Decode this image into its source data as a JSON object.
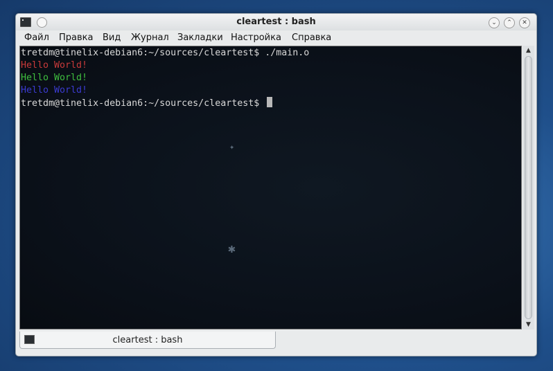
{
  "window": {
    "title": "cleartest : bash"
  },
  "menu": [
    "Файл",
    "Правка",
    "Вид",
    "Журнал",
    "Закладки",
    "Настройка",
    "Справка"
  ],
  "terminal": {
    "lines": [
      {
        "text": "tretdm@tinelix-debian6:~/sources/cleartest$ ./main.o",
        "color": "#d8d8d8"
      },
      {
        "text": "Hello World!",
        "color": "#c83a3a"
      },
      {
        "text": "Hello World!",
        "color": "#3fbf3f"
      },
      {
        "text": "Hello World!",
        "color": "#3b3bd0"
      },
      {
        "text": "tretdm@tinelix-debian6:~/sources/cleartest$ ",
        "color": "#d8d8d8"
      }
    ]
  },
  "tab": {
    "label": "cleartest : bash"
  },
  "icons": {
    "app": "terminal-icon",
    "pin": "pin-icon",
    "minimize": "chevron-down-icon",
    "maximize": "chevron-up-icon",
    "close": "close-icon"
  }
}
